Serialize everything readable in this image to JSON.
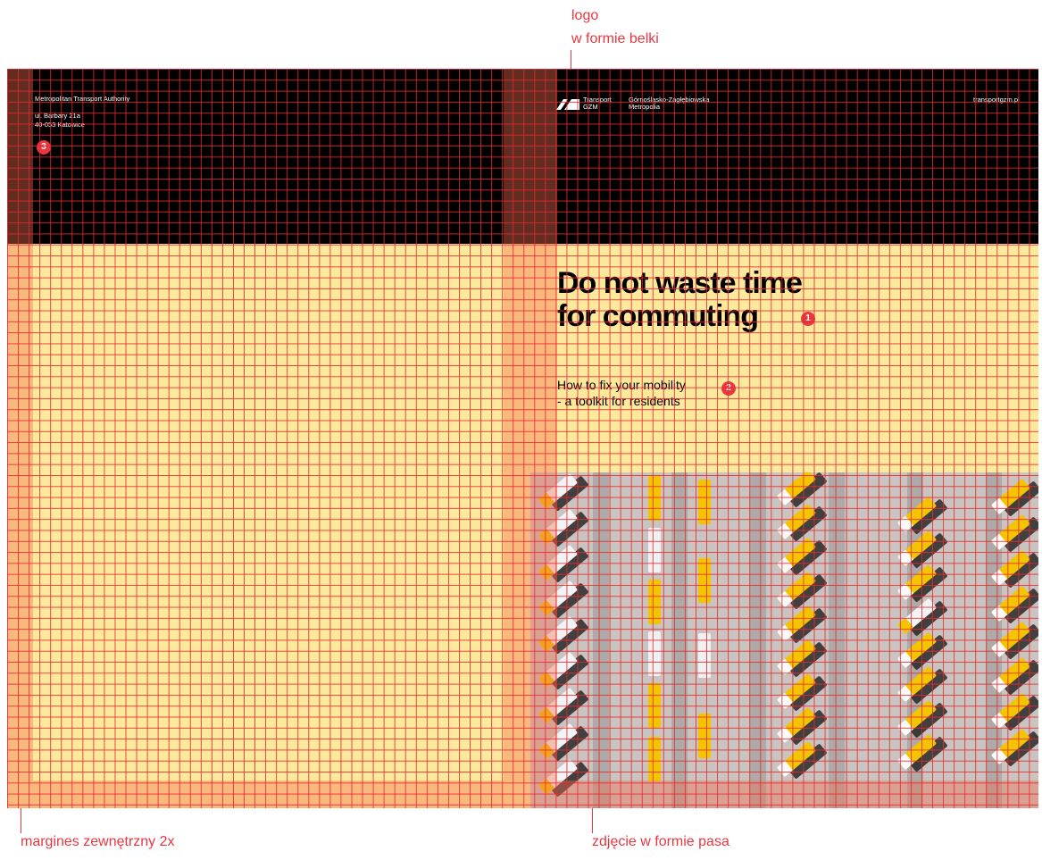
{
  "annotations": {
    "logo_line1": "logo",
    "logo_line2": "w formie belki",
    "margin": "margines zewnętrzny 2x",
    "photo": "zdjęcie w formie pasa"
  },
  "back_cover": {
    "org": "Metropolitan Transport Authority",
    "address_line1": "ul. Barbary 21a",
    "address_line2": "40-053 Katowice",
    "marker": "3"
  },
  "front_cover": {
    "logo_text1": "Transport",
    "logo_text2": "GZM",
    "metro_line1": "Górnośląsko-Zagłębiowska",
    "metro_line2": "Metropolia",
    "url": "transportgzm.pl",
    "title_line1": "Do not waste time",
    "title_line2": "for commuting",
    "title_marker": "1",
    "subtitle_line1": "How to fix your mobility",
    "subtitle_line2": "- a toolkit for residents",
    "subtitle_marker": "2"
  },
  "colors": {
    "accent": "#e8373f",
    "background": "#fde99b",
    "band": "#000000",
    "bus_yellow": "#f5c400"
  }
}
